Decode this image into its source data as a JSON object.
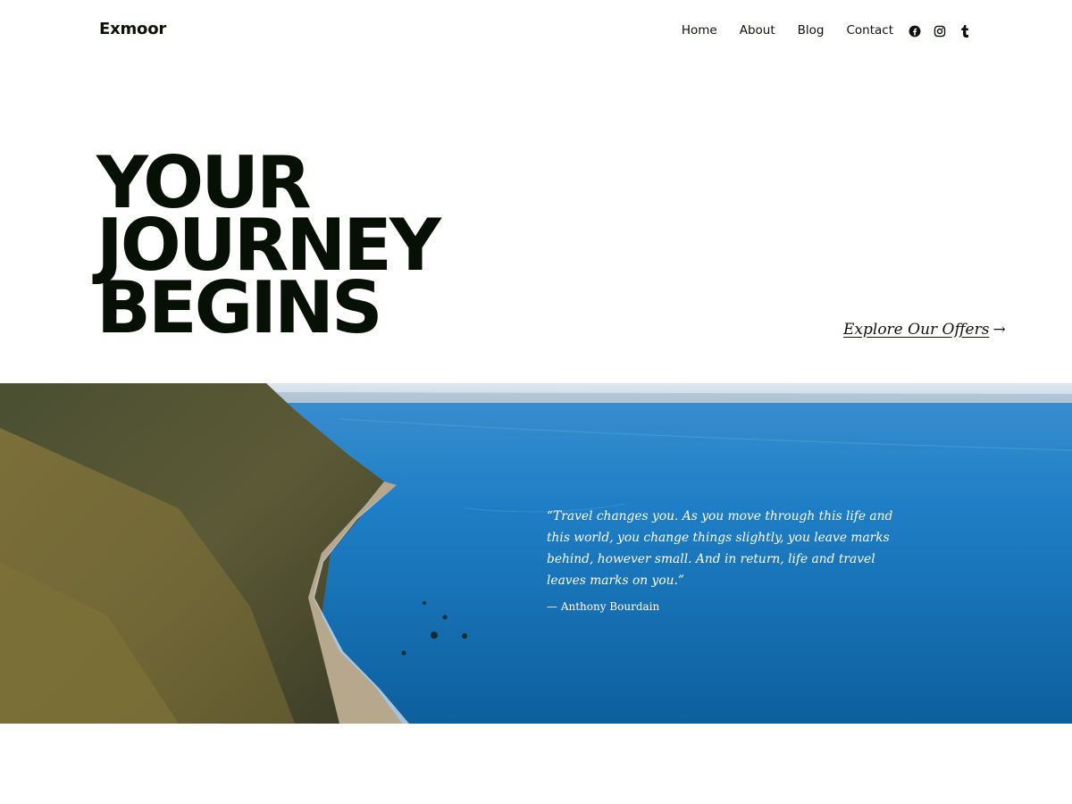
{
  "site": {
    "title": "Exmoor"
  },
  "nav": {
    "items": [
      "Home",
      "About",
      "Blog",
      "Contact"
    ]
  },
  "social": {
    "icons": [
      "facebook-icon",
      "instagram-icon",
      "tumblr-icon"
    ]
  },
  "hero": {
    "title_lines": [
      "YOUR",
      "JOURNEY",
      "BEGINS"
    ],
    "cta_label": "Explore Our Offers",
    "cta_arrow": "→"
  },
  "cover": {
    "quote": "“Travel changes you. As you move through this life and this world, you change things slightly, you leave marks behind, however small. And in return, life and travel leaves marks on you.”",
    "citation": "— Anthony Bourdain"
  },
  "colors": {
    "text": "#0c1308",
    "sea": "#1d7fc4",
    "white": "#ffffff"
  }
}
